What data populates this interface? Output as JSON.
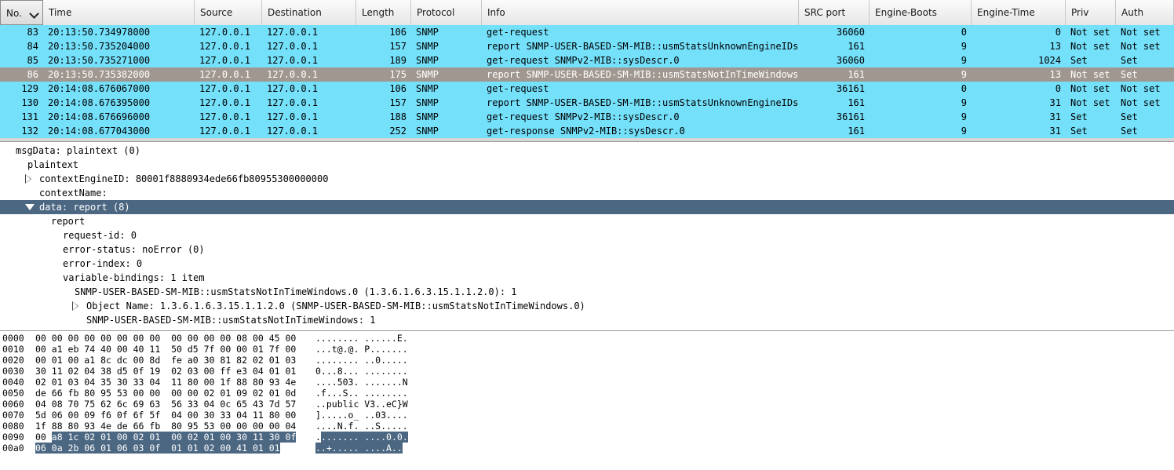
{
  "packet_list": {
    "columns": [
      "No.",
      "Time",
      "Source",
      "Destination",
      "Length",
      "Protocol",
      "Info",
      "SRC port",
      "Engine-Boots",
      "Engine-Time",
      "Priv",
      "Auth"
    ],
    "rows": [
      {
        "no": "83",
        "time": "20:13:50.734978000",
        "src": "127.0.0.1",
        "dst": "127.0.0.1",
        "len": "106",
        "proto": "SNMP",
        "info": "get-request",
        "srcport": "36060",
        "boots": "0",
        "etime": "0",
        "priv": "Not set",
        "auth": "Not set",
        "selected": false
      },
      {
        "no": "84",
        "time": "20:13:50.735204000",
        "src": "127.0.0.1",
        "dst": "127.0.0.1",
        "len": "157",
        "proto": "SNMP",
        "info": "report SNMP-USER-BASED-SM-MIB::usmStatsUnknownEngineIDs.0",
        "srcport": "161",
        "boots": "9",
        "etime": "13",
        "priv": "Not set",
        "auth": "Not set",
        "selected": false
      },
      {
        "no": "85",
        "time": "20:13:50.735271000",
        "src": "127.0.0.1",
        "dst": "127.0.0.1",
        "len": "189",
        "proto": "SNMP",
        "info": "get-request SNMPv2-MIB::sysDescr.0",
        "srcport": "36060",
        "boots": "9",
        "etime": "1024",
        "priv": "Set",
        "auth": "Set",
        "selected": false
      },
      {
        "no": "86",
        "time": "20:13:50.735382000",
        "src": "127.0.0.1",
        "dst": "127.0.0.1",
        "len": "175",
        "proto": "SNMP",
        "info": "report SNMP-USER-BASED-SM-MIB::usmStatsNotInTimeWindows.0",
        "srcport": "161",
        "boots": "9",
        "etime": "13",
        "priv": "Not set",
        "auth": "Set",
        "selected": true
      },
      {
        "no": "129",
        "time": "20:14:08.676067000",
        "src": "127.0.0.1",
        "dst": "127.0.0.1",
        "len": "106",
        "proto": "SNMP",
        "info": "get-request",
        "srcport": "36161",
        "boots": "0",
        "etime": "0",
        "priv": "Not set",
        "auth": "Not set",
        "selected": false
      },
      {
        "no": "130",
        "time": "20:14:08.676395000",
        "src": "127.0.0.1",
        "dst": "127.0.0.1",
        "len": "157",
        "proto": "SNMP",
        "info": "report SNMP-USER-BASED-SM-MIB::usmStatsUnknownEngineIDs.0",
        "srcport": "161",
        "boots": "9",
        "etime": "31",
        "priv": "Not set",
        "auth": "Not set",
        "selected": false
      },
      {
        "no": "131",
        "time": "20:14:08.676696000",
        "src": "127.0.0.1",
        "dst": "127.0.0.1",
        "len": "188",
        "proto": "SNMP",
        "info": "get-request SNMPv2-MIB::sysDescr.0",
        "srcport": "36161",
        "boots": "9",
        "etime": "31",
        "priv": "Set",
        "auth": "Set",
        "selected": false
      },
      {
        "no": "132",
        "time": "20:14:08.677043000",
        "src": "127.0.0.1",
        "dst": "127.0.0.1",
        "len": "252",
        "proto": "SNMP",
        "info": "get-response SNMPv2-MIB::sysDescr.0",
        "srcport": "161",
        "boots": "9",
        "etime": "31",
        "priv": "Set",
        "auth": "Set",
        "selected": false
      }
    ]
  },
  "details": [
    {
      "text": "msgData: plaintext (0)",
      "depth": 0,
      "state": "open",
      "selected": false
    },
    {
      "text": "plaintext",
      "depth": 1,
      "state": "open",
      "selected": false
    },
    {
      "text": "contextEngineID: 80001f8880934ede66fb80955300000000",
      "depth": 2,
      "state": "closed",
      "selected": false
    },
    {
      "text": "contextName:",
      "depth": 2,
      "state": "leaf",
      "selected": false
    },
    {
      "text": "data: report (8)",
      "depth": 2,
      "state": "open",
      "selected": true
    },
    {
      "text": "report",
      "depth": 3,
      "state": "open",
      "selected": false
    },
    {
      "text": "request-id: 0",
      "depth": 4,
      "state": "leaf",
      "selected": false
    },
    {
      "text": "error-status: noError (0)",
      "depth": 4,
      "state": "leaf",
      "selected": false
    },
    {
      "text": "error-index: 0",
      "depth": 4,
      "state": "leaf",
      "selected": false
    },
    {
      "text": "variable-bindings: 1 item",
      "depth": 4,
      "state": "open",
      "selected": false
    },
    {
      "text": "SNMP-USER-BASED-SM-MIB::usmStatsNotInTimeWindows.0 (1.3.6.1.6.3.15.1.1.2.0): 1",
      "depth": 5,
      "state": "open",
      "selected": false
    },
    {
      "text": "Object Name: 1.3.6.1.6.3.15.1.1.2.0 (SNMP-USER-BASED-SM-MIB::usmStatsNotInTimeWindows.0)",
      "depth": 6,
      "state": "closed",
      "selected": false
    },
    {
      "text": "SNMP-USER-BASED-SM-MIB::usmStatsNotInTimeWindows: 1",
      "depth": 6,
      "state": "leaf",
      "selected": false
    }
  ],
  "hex": [
    {
      "offset": "0000",
      "bytes": [
        "00",
        "00",
        "00",
        "00",
        "00",
        "00",
        "00",
        "00",
        "00",
        "00",
        "00",
        "00",
        "08",
        "00",
        "45",
        "00"
      ],
      "ascii": "........ ......E.",
      "hl_from": -1
    },
    {
      "offset": "0010",
      "bytes": [
        "00",
        "a1",
        "eb",
        "74",
        "40",
        "00",
        "40",
        "11",
        "50",
        "d5",
        "7f",
        "00",
        "00",
        "01",
        "7f",
        "00"
      ],
      "ascii": "...t@.@. P.......",
      "hl_from": -1
    },
    {
      "offset": "0020",
      "bytes": [
        "00",
        "01",
        "00",
        "a1",
        "8c",
        "dc",
        "00",
        "8d",
        "fe",
        "a0",
        "30",
        "81",
        "82",
        "02",
        "01",
        "03"
      ],
      "ascii": "........ ..0.....",
      "hl_from": -1
    },
    {
      "offset": "0030",
      "bytes": [
        "30",
        "11",
        "02",
        "04",
        "38",
        "d5",
        "0f",
        "19",
        "02",
        "03",
        "00",
        "ff",
        "e3",
        "04",
        "01",
        "01"
      ],
      "ascii": "0...8... ........",
      "hl_from": -1
    },
    {
      "offset": "0040",
      "bytes": [
        "02",
        "01",
        "03",
        "04",
        "35",
        "30",
        "33",
        "04",
        "11",
        "80",
        "00",
        "1f",
        "88",
        "80",
        "93",
        "4e"
      ],
      "ascii": "....503. .......N",
      "hl_from": -1
    },
    {
      "offset": "0050",
      "bytes": [
        "de",
        "66",
        "fb",
        "80",
        "95",
        "53",
        "00",
        "00",
        "00",
        "00",
        "02",
        "01",
        "09",
        "02",
        "01",
        "0d"
      ],
      "ascii": ".f...S.. ........",
      "hl_from": -1
    },
    {
      "offset": "0060",
      "bytes": [
        "04",
        "08",
        "70",
        "75",
        "62",
        "6c",
        "69",
        "63",
        "56",
        "33",
        "04",
        "0c",
        "65",
        "43",
        "7d",
        "57"
      ],
      "ascii": "..public V3..eC}W",
      "hl_from": -1
    },
    {
      "offset": "0070",
      "bytes": [
        "5d",
        "06",
        "00",
        "09",
        "f6",
        "0f",
        "6f",
        "5f",
        "04",
        "00",
        "30",
        "33",
        "04",
        "11",
        "80",
        "00"
      ],
      "ascii": "].....o_ ..03....",
      "hl_from": -1
    },
    {
      "offset": "0080",
      "bytes": [
        "1f",
        "88",
        "80",
        "93",
        "4e",
        "de",
        "66",
        "fb",
        "80",
        "95",
        "53",
        "00",
        "00",
        "00",
        "00",
        "04"
      ],
      "ascii": "....N.f. ..S.....",
      "hl_from": -1
    },
    {
      "offset": "0090",
      "bytes": [
        "00",
        "a8",
        "1c",
        "02",
        "01",
        "00",
        "02",
        "01",
        "00",
        "02",
        "01",
        "00",
        "30",
        "11",
        "30",
        "0f"
      ],
      "ascii": "........ ....0.0.",
      "hl_from": 1
    },
    {
      "offset": "00a0",
      "bytes": [
        "06",
        "0a",
        "2b",
        "06",
        "01",
        "06",
        "03",
        "0f",
        "01",
        "01",
        "02",
        "00",
        "41",
        "01",
        "01"
      ],
      "ascii": "..+..... ....A..",
      "hl_from": 0
    }
  ]
}
